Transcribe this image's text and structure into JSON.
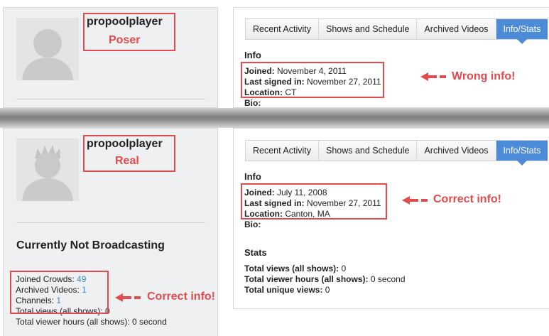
{
  "colors": {
    "accent_tab": "#4c8bd8",
    "annotation_red": "#e24b4b",
    "link_blue": "#3a86d6"
  },
  "poser": {
    "username": "propoolplayer",
    "label": "Poser",
    "tabs": [
      "Recent Activity",
      "Shows and Schedule",
      "Archived Videos",
      "Info/Stats"
    ],
    "active_tab": "Info/Stats",
    "info_heading": "Info",
    "joined_label": "Joined:",
    "joined_value": " November 4, 2011",
    "last_label": "Last signed in:",
    "last_value": " November 27, 2011",
    "location_label": "Location:",
    "location_value": " CT",
    "bio_label": "Bio:",
    "annotation": "Wrong info!"
  },
  "real": {
    "username": "propoolplayer",
    "label": "Real",
    "tabs": [
      "Recent Activity",
      "Shows and Schedule",
      "Archived Videos",
      "Info/Stats"
    ],
    "active_tab": "Info/Stats",
    "info_heading": "Info",
    "joined_label": "Joined:",
    "joined_value": " July 11, 2008",
    "last_label": "Last signed in:",
    "last_value": " November 27, 2011",
    "location_label": "Location:",
    "location_value": " Canton, MA",
    "bio_label": "Bio:",
    "annotation": "Correct info!",
    "broadcast_status": "Currently Not Broadcasting",
    "sidebar_stats": {
      "joined_crowds_label": "Joined Crowds: ",
      "joined_crowds_value": "49",
      "archived_videos_label": "Archived Videos: ",
      "archived_videos_value": "1",
      "channels_label": "Channels: ",
      "channels_value": "1",
      "total_views": "Total views (all shows): 0",
      "total_viewer_hours": "Total viewer hours (all shows): 0 second"
    },
    "sidebar_annotation": "Correct info!",
    "stats_heading": "Stats",
    "stats": [
      {
        "label": "Total views (all shows):",
        "value": " 0"
      },
      {
        "label": "Total viewer hours (all shows):",
        "value": " 0 second"
      },
      {
        "label": "Total unique views:",
        "value": " 0"
      }
    ]
  }
}
